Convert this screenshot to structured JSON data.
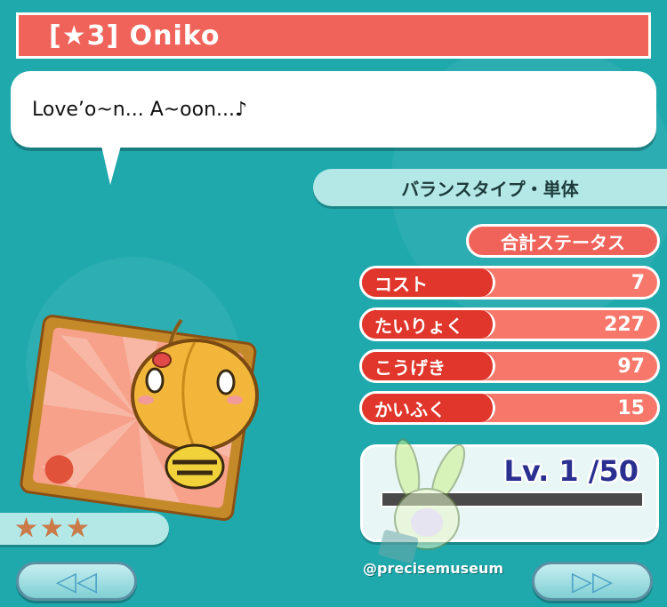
{
  "header": {
    "title": "[★3] Oniko"
  },
  "dialogue": {
    "text": "Love’o~n... A~oon...♪"
  },
  "type_label": "バランスタイプ・単体",
  "stats": {
    "total_label": "合計ステータス",
    "rows": [
      {
        "label": "コスト",
        "value": "7"
      },
      {
        "label": "たいりょく",
        "value": "227"
      },
      {
        "label": "こうげき",
        "value": "97"
      },
      {
        "label": "かいふく",
        "value": "15"
      }
    ]
  },
  "level": {
    "text": "Lv. 1 /50",
    "progress": 0
  },
  "rarity": {
    "stars": 3
  },
  "nav": {
    "prev_label": "◁◁",
    "next_label": "▷▷"
  },
  "watermark": "@precisemuseum",
  "icons": {
    "prev": "rewind-icon",
    "next": "fast-forward-icon",
    "star": "bronze-star-icon"
  },
  "colors": {
    "accent": "#f0635a",
    "background": "#20a9ad",
    "panel": "#b3e8e6"
  }
}
